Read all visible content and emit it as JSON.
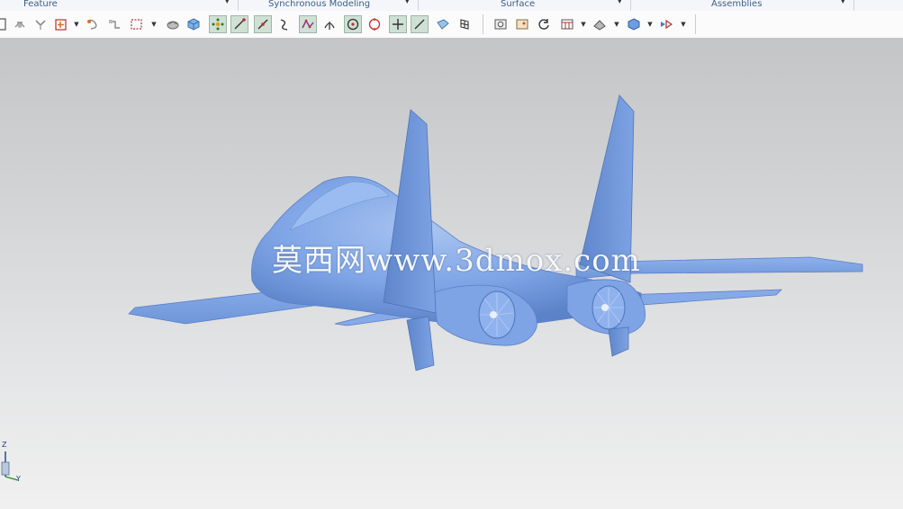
{
  "ribbon_groups": [
    {
      "label": "Feature"
    },
    {
      "label": "Synchronous Modeling"
    },
    {
      "label": "Surface"
    },
    {
      "label": "Assemblies"
    }
  ],
  "toolbar_icons": [
    "sketch-icon",
    "extrude-icon",
    "feature-op-icon",
    "datum-box-icon",
    "trim-icon",
    "datum-point-icon",
    "select-box-icon",
    "shaded-view-icon",
    "cube-view-icon",
    "snap-points-icon",
    "snap-line-icon",
    "snap-tangent-icon",
    "curve-icon",
    "spline-icon",
    "intersect-icon",
    "center-point-icon",
    "circle-point-icon",
    "cross-point-icon",
    "edge-icon",
    "face-view-icon",
    "grid-icon",
    "camera-icon",
    "image-view-icon",
    "rotate-icon",
    "table-icon",
    "render-icon",
    "box-view-icon",
    "display-icon"
  ],
  "viewport": {
    "watermark": "莫西网www.3dmox.com",
    "triad": {
      "z_label": "Z",
      "y_label": "Y"
    }
  },
  "colors": {
    "model": "#7ea4e6",
    "model_dark": "#5c83c9",
    "ribbon_text": "#3a5f8c",
    "active_icon_bg": "#cfe0d4"
  }
}
